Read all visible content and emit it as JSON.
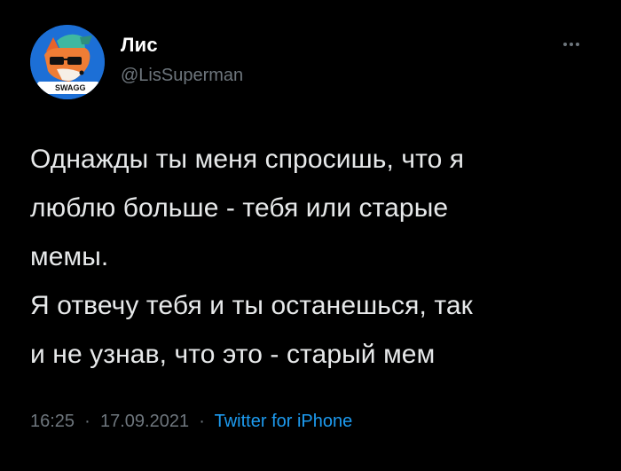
{
  "user": {
    "display_name": "Лис",
    "handle": "@LisSuperman",
    "avatar_badge_text": "SWAGG"
  },
  "tweet": {
    "lines": [
      "Однажды ты меня спросишь, что я",
      "люблю больше - тебя или старые",
      "мемы.",
      "Я отвечу тебя и ты останешься, так",
      "и не узнав, что это - старый мем"
    ]
  },
  "meta": {
    "time": "16:25",
    "separator": "·",
    "date": "17.09.2021",
    "source": "Twitter for iPhone"
  },
  "icons": {
    "more": "more-options-icon"
  },
  "colors": {
    "background": "#000000",
    "text": "#e7e9ea",
    "secondary": "#6e767d",
    "link": "#1d9bf0"
  }
}
